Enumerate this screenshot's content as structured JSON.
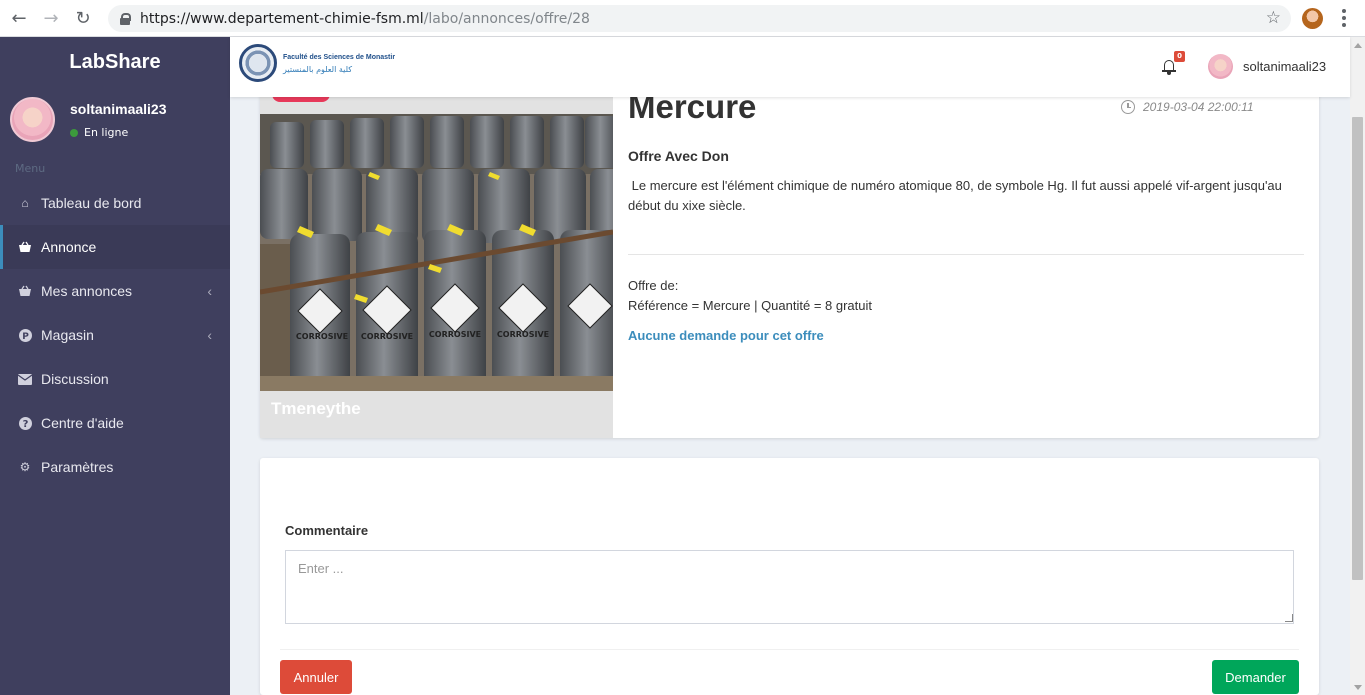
{
  "browser": {
    "url_host": "https://www.departement-chimie-fsm.ml",
    "url_path": "/labo/annonces/offre/28"
  },
  "sidebar": {
    "brand": "LabShare",
    "user": {
      "name": "soltanimaali23",
      "status": "En ligne"
    },
    "menu_header": "Menu",
    "items": [
      {
        "label": "Tableau de bord",
        "icon": "home-icon",
        "active": false
      },
      {
        "label": "Annonce",
        "icon": "basket-icon",
        "active": true
      },
      {
        "label": "Mes annonces",
        "icon": "basket-icon",
        "active": false,
        "has_chevron": true
      },
      {
        "label": "Magasin",
        "icon": "parking-icon",
        "active": false,
        "has_chevron": true
      },
      {
        "label": "Discussion",
        "icon": "envelope-icon",
        "active": false
      },
      {
        "label": "Centre d'aide",
        "icon": "question-icon",
        "active": false
      },
      {
        "label": "Paramètres",
        "icon": "gear-icon",
        "active": false
      }
    ]
  },
  "topbar": {
    "logo_text": "Faculté des Sciences de Monastir",
    "logo_arabic": "كلية العلوم بالمنستير",
    "notification_count": "0",
    "username": "soltanimaali23"
  },
  "offer": {
    "title": "Mercure",
    "date": "2019-03-04 22:00:11",
    "type": "Offre Avec Don",
    "description": " Le mercure est l'élément chimique de numéro atomique 80, de symbole Hg. Il fut aussi appelé vif-argent jusqu'au début du xixe siècle.",
    "image_caption": "Tmeneythe",
    "offer_label": "Offre de:",
    "reference_line": "Référence = Mercure | Quantité = 8 gratuit",
    "no_request": "Aucune demande pour cet offre",
    "container_label": "CORROSIVE"
  },
  "comment": {
    "label": "Commentaire",
    "placeholder": "Enter ...",
    "cancel_label": "Annuler",
    "submit_label": "Demander"
  },
  "colors": {
    "sidebar_bg": "#3f3f5e",
    "accent_blue": "#3c8dbc",
    "danger": "#dd4b39",
    "success": "#00a65a",
    "tag_pink": "#e8395a"
  }
}
